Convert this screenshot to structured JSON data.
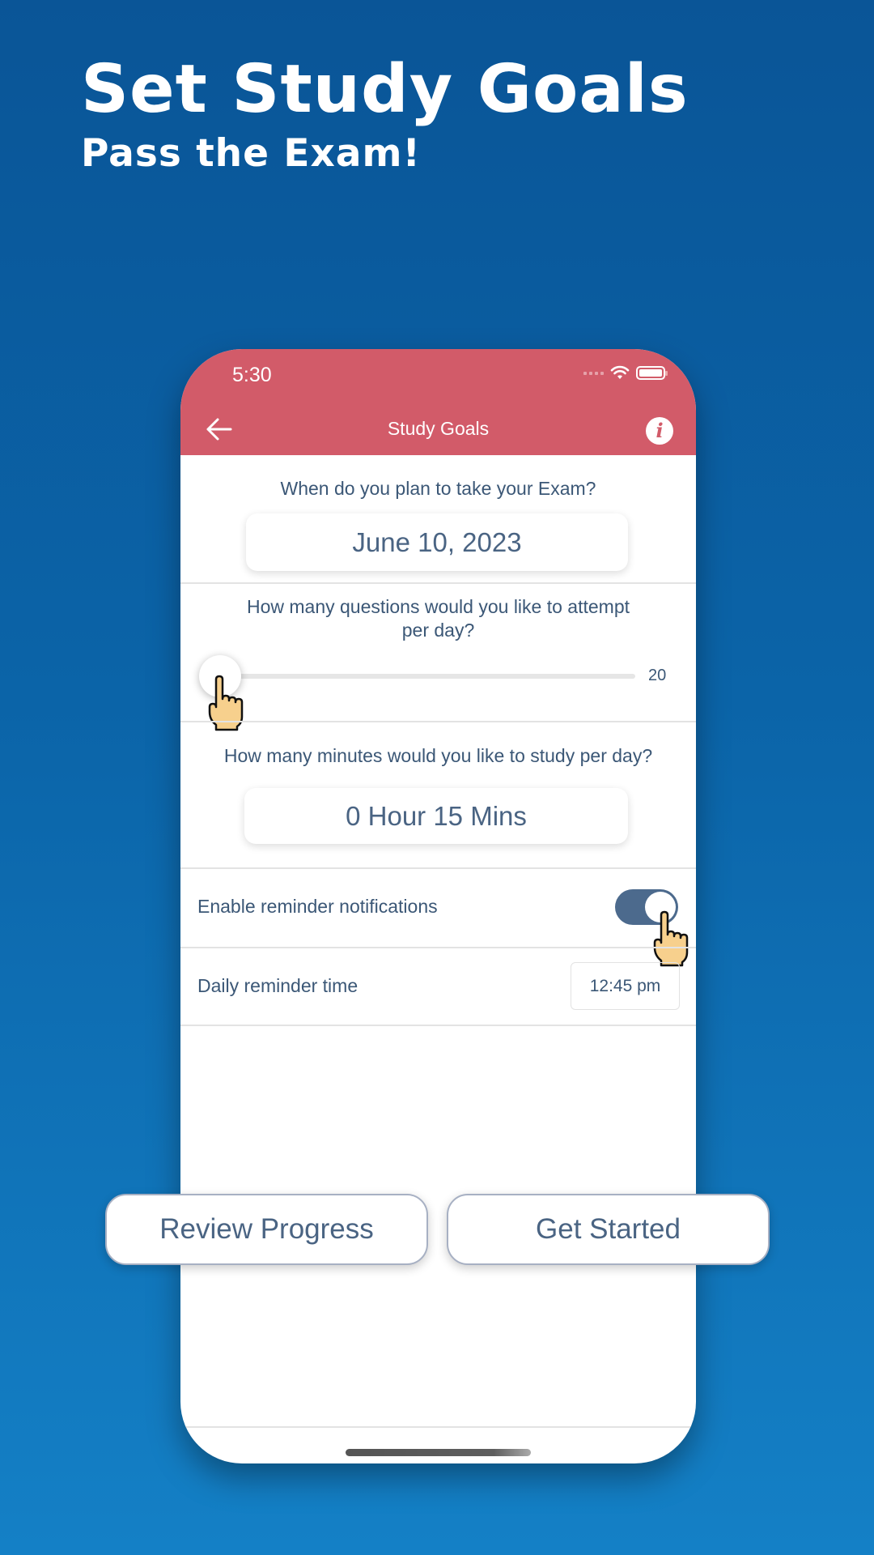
{
  "hero": {
    "title": "Set Study Goals",
    "subtitle": "Pass the Exam!"
  },
  "status_bar": {
    "time": "5:30",
    "icons": [
      "signal-dots-icon",
      "wifi-icon",
      "battery-icon"
    ]
  },
  "nav": {
    "back_icon": "arrow-left-icon",
    "title": "Study Goals",
    "info_icon": "info-icon",
    "info_glyph": "i"
  },
  "exam_date": {
    "question": "When do you plan to take your Exam?",
    "value": "June 10, 2023"
  },
  "questions_per_day": {
    "question_line1": "How many questions would you like to attempt",
    "question_line2": "per day?",
    "value": "20",
    "slider_fraction": 0.0
  },
  "study_minutes": {
    "question": "How many minutes would you like to study per day?",
    "value": "0 Hour 15 Mins"
  },
  "reminders": {
    "enable_label": "Enable reminder notifications",
    "enabled": true,
    "time_label": "Daily reminder time",
    "time_value": "12:45 pm"
  },
  "buttons": {
    "review_progress": "Review Progress",
    "get_started": "Get Started"
  },
  "colors": {
    "header": "#d25b69",
    "text": "#3b5776",
    "toggle_on": "#4c6a8d",
    "background": "#0b64a8"
  }
}
